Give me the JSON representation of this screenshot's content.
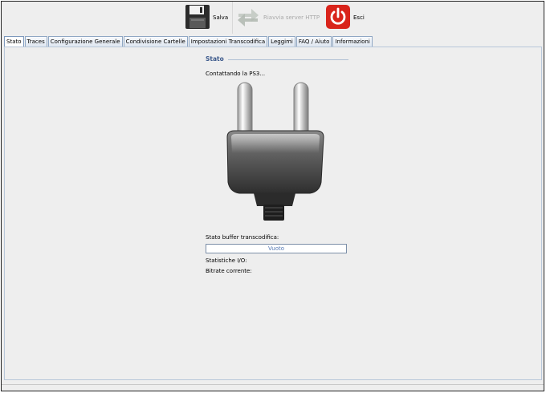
{
  "toolbar": {
    "save_label": "Salva",
    "restart_label": "Riavvia server HTTP",
    "exit_label": "Esci"
  },
  "tabs": [
    {
      "label": "Stato"
    },
    {
      "label": "Traces"
    },
    {
      "label": "Configurazione Generale"
    },
    {
      "label": "Condivisione Cartelle"
    },
    {
      "label": "Impostazioni Transcodifica"
    },
    {
      "label": "Leggimi"
    },
    {
      "label": "FAQ / Aiuto"
    },
    {
      "label": "Informazioni"
    }
  ],
  "status_panel": {
    "section_title": "Stato",
    "connection_text": "Contattando la PS3...",
    "buffer_label": "Stato buffer transcodifica:",
    "buffer_value": "Vuoto",
    "io_stats_label": "Statistiche I/O:",
    "bitrate_label": "Bitrate corrente:"
  },
  "icons": {
    "save": "floppy-disk-icon",
    "restart": "refresh-arrows-icon",
    "exit": "power-icon",
    "status": "power-plug-icon"
  },
  "colors": {
    "accent": "#3d5a8c",
    "exit_red": "#d9241b"
  }
}
